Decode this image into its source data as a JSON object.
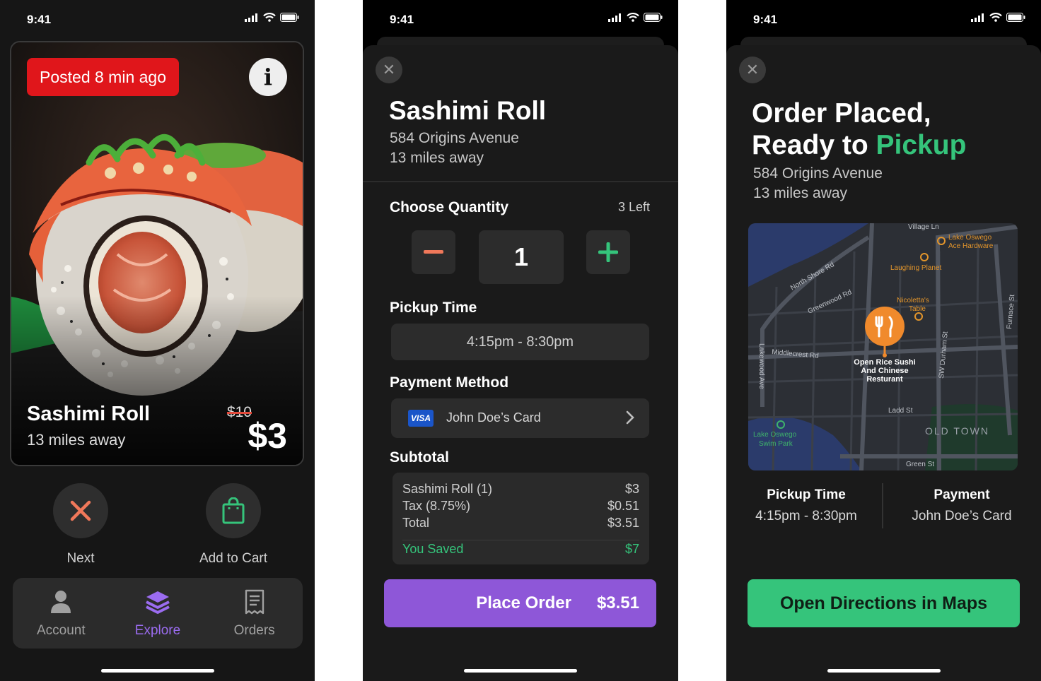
{
  "status_bar": {
    "time": "9:41"
  },
  "explore": {
    "badge": "Posted 8 min ago",
    "info_glyph": "i",
    "item_name": "Sashimi Roll",
    "distance": "13 miles away",
    "old_price": "$10",
    "new_price": "$3",
    "next_label": "Next",
    "add_to_cart_label": "Add to Cart",
    "tabs": [
      {
        "label": "Account",
        "icon": "person-icon",
        "active": false
      },
      {
        "label": "Explore",
        "icon": "layers-icon",
        "active": true
      },
      {
        "label": "Orders",
        "icon": "receipt-icon",
        "active": false
      }
    ],
    "colors": {
      "badge": "#e0161b",
      "accent": "#9b6cf0",
      "next_icon": "#f0785a",
      "cart_icon": "#35c47b"
    }
  },
  "order": {
    "close_glyph": "✕",
    "item_name": "Sashimi Roll",
    "address": "584 Origins Avenue",
    "distance": "13 miles away",
    "quantity_label": "Choose Quantity",
    "quantity_left": "3 Left",
    "quantity": "1",
    "pickup_label": "Pickup Time",
    "pickup_time": "4:15pm - 8:30pm",
    "payment_label": "Payment Method",
    "card_brand": "VISA",
    "card_name": "John Doe’s Card",
    "subtotal_label": "Subtotal",
    "lines": [
      {
        "label": "Sashimi Roll (1)",
        "value": "$3"
      },
      {
        "label": "Tax (8.75%)",
        "value": "$0.51"
      },
      {
        "label": "Total",
        "value": "$3.51"
      }
    ],
    "saved_label": "You Saved",
    "saved_value": "$7",
    "place_order_label": "Place Order",
    "place_order_price": "$3.51",
    "colors": {
      "button": "#8e57d8",
      "saved": "#35c47b",
      "minus": "#f0785a",
      "plus": "#35c47b"
    }
  },
  "confirmation": {
    "close_glyph": "✕",
    "title_line1": "Order Placed,",
    "title_line2_prefix": "Ready to",
    "title_line2_highlight": "Pickup",
    "address": "584 Origins Avenue",
    "distance": "13 miles away",
    "map": {
      "streets": [
        "Village Ln",
        "North Shore Rd",
        "Greenwood Rd",
        "Middlecrest Rd",
        "Lakewood Ave",
        "SW Durham St",
        "Furnace St",
        "Ladd St",
        "Green St"
      ],
      "places": [
        "Lake Oswego Ace Hardware",
        "Laughing Planet",
        "Nicoletta's Table",
        "Lake Oswego Swim Park"
      ],
      "place_lines": {
        "ace": [
          "Lake Oswego",
          "Ace Hardware"
        ],
        "nicoletta": [
          "Nicoletta's",
          "Table"
        ],
        "swim": [
          "Lake Oswego",
          "Swim Park"
        ]
      },
      "restaurant_lines": [
        "Open Rice Sushi",
        "And Chinese",
        "Resturant"
      ],
      "district": "OLD TOWN"
    },
    "pickup_heading": "Pickup Time",
    "pickup_value": "4:15pm - 8:30pm",
    "payment_heading": "Payment",
    "payment_value": "John Doe’s Card",
    "directions_label": "Open Directions in Maps",
    "colors": {
      "accent": "#35c47b",
      "pin": "#f08a2c"
    }
  }
}
